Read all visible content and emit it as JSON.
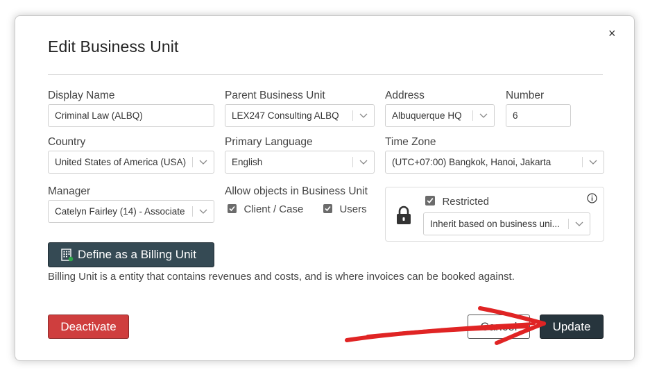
{
  "dialog": {
    "title": "Edit Business Unit",
    "close_label": "×"
  },
  "form": {
    "display_name": {
      "label": "Display Name",
      "value": "Criminal Law (ALBQ)"
    },
    "parent_business_unit": {
      "label": "Parent Business Unit",
      "value": "LEX247 Consulting ALBQ"
    },
    "address": {
      "label": "Address",
      "value": "Albuquerque HQ"
    },
    "number": {
      "label": "Number",
      "value": "6"
    },
    "country": {
      "label": "Country",
      "value": "United States of America (USA)"
    },
    "primary_language": {
      "label": "Primary Language",
      "value": "English"
    },
    "time_zone": {
      "label": "Time Zone",
      "value": "(UTC+07:00) Bangkok, Hanoi, Jakarta"
    },
    "manager": {
      "label": "Manager",
      "value": "Catelyn Fairley (14) - Associate"
    },
    "allow_objects": {
      "label": "Allow objects in Business Unit",
      "options": [
        {
          "label": "Client / Case",
          "checked": true
        },
        {
          "label": "Users",
          "checked": true
        }
      ]
    },
    "restricted": {
      "label": "Restricted",
      "checked": true,
      "select_value": "Inherit based on business uni...",
      "icons": [
        "lock-icon",
        "info-icon"
      ]
    }
  },
  "billing": {
    "button_label": "Define as a Billing Unit",
    "description": "Billing Unit is a entity that contains revenues and costs, and is where invoices can be booked against."
  },
  "actions": {
    "deactivate": "Deactivate",
    "cancel": "Cancel",
    "update": "Update"
  },
  "colors": {
    "billing_button": "#354a54",
    "deactivate_button": "#cf3e3e",
    "update_button": "#27353d",
    "annotation_arrow": "#e02424"
  }
}
